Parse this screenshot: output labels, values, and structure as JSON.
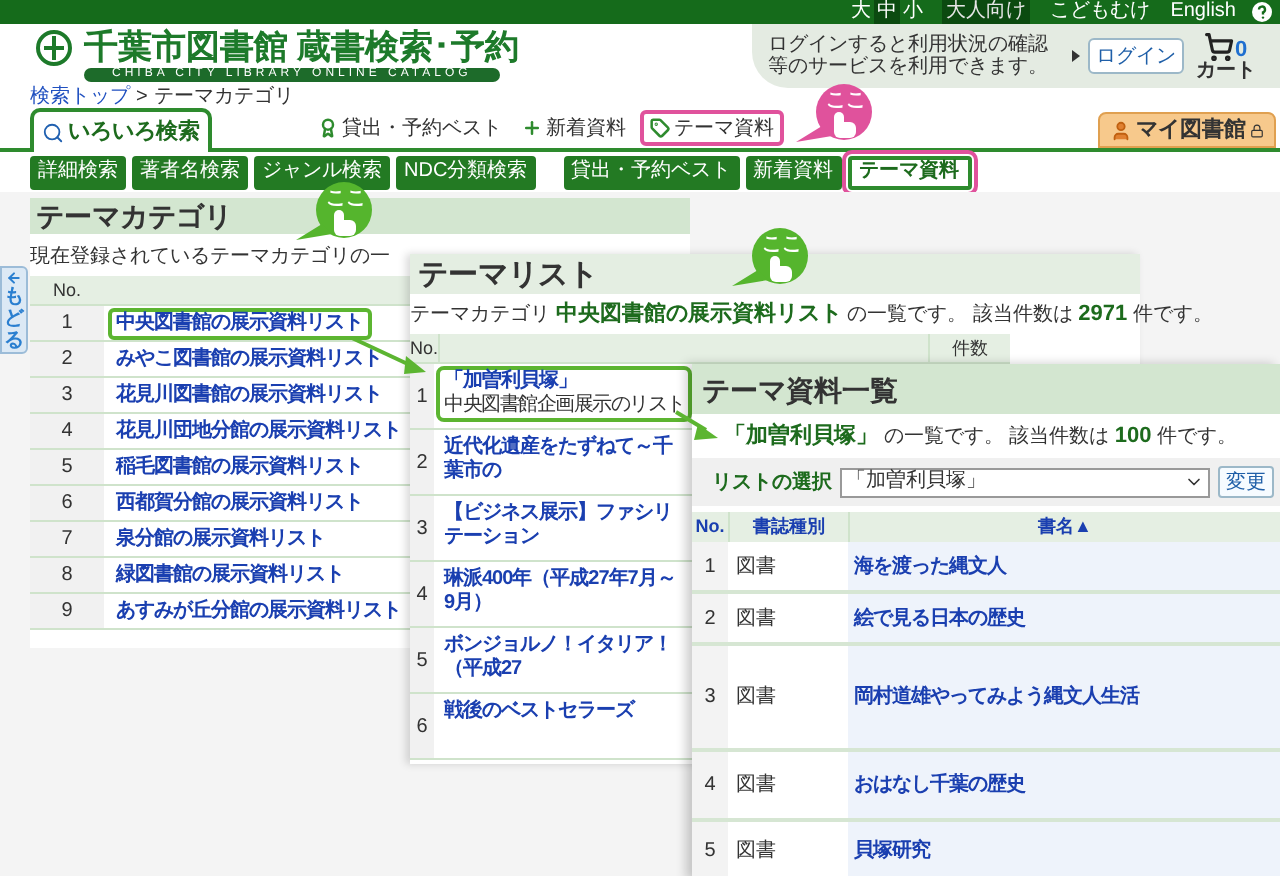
{
  "top_bar": {
    "font_sizes": [
      {
        "label": "大",
        "selected": false
      },
      {
        "label": "中",
        "selected": true
      },
      {
        "label": "小",
        "selected": false
      }
    ],
    "audiences": [
      {
        "label": "大人向け",
        "selected": true
      },
      {
        "label": "こどもむけ",
        "selected": false
      }
    ],
    "language": "English"
  },
  "header": {
    "title": "千葉市図書館 蔵書検索･予約",
    "subtitle": "CHIBA CITY LIBRARY ONLINE CATALOG",
    "login_note": "ログインすると利用状況の確認等のサービスを利用できます。",
    "login_button": "ログイン",
    "cart_count": "0",
    "cart_label": "カート"
  },
  "breadcrumb": {
    "link": "検索トップ",
    "separator": ">",
    "current": "テーマカテゴリ"
  },
  "main_tabs": [
    {
      "label": "いろいろ検索",
      "kind": "tab",
      "selected": true,
      "highlighted": false
    },
    {
      "label": "貸出・予約ベスト",
      "kind": "best",
      "selected": false,
      "highlighted": false
    },
    {
      "label": "新着資料",
      "kind": "new",
      "selected": false,
      "highlighted": false
    },
    {
      "label": "テーマ資料",
      "kind": "theme",
      "selected": false,
      "highlighted": true
    }
  ],
  "my_library": "マイ図書館",
  "search_buttons": [
    {
      "label": "詳細検索",
      "selected": false,
      "highlighted": false
    },
    {
      "label": "著者名検索",
      "selected": false,
      "highlighted": false
    },
    {
      "label": "ジャンル検索",
      "selected": false,
      "highlighted": false
    },
    {
      "label": "NDC分類検索",
      "selected": false,
      "highlighted": false
    }
  ],
  "list_buttons": [
    {
      "label": "貸出・予約ベスト",
      "selected": false,
      "highlighted": false
    },
    {
      "label": "新着資料",
      "selected": false,
      "highlighted": false
    },
    {
      "label": "テーマ資料",
      "selected": true,
      "highlighted": true
    }
  ],
  "back_tab": "もどる",
  "category_panel": {
    "title": "テーマカテゴリ",
    "description": "現在登録されているテーマカテゴリの一",
    "column": "No.",
    "rows": [
      {
        "no": "1",
        "name": "中央図書館の展示資料リスト",
        "highlighted": true
      },
      {
        "no": "2",
        "name": "みやこ図書館の展示資料リスト",
        "highlighted": false
      },
      {
        "no": "3",
        "name": "花見川図書館の展示資料リスト",
        "highlighted": false
      },
      {
        "no": "4",
        "name": "花見川団地分館の展示資料リスト",
        "highlighted": false
      },
      {
        "no": "5",
        "name": "稲毛図書館の展示資料リスト",
        "highlighted": false
      },
      {
        "no": "6",
        "name": "西都賀分館の展示資料リスト",
        "highlighted": false
      },
      {
        "no": "7",
        "name": "泉分館の展示資料リスト",
        "highlighted": false
      },
      {
        "no": "8",
        "name": "緑図書館の展示資料リスト",
        "highlighted": false
      },
      {
        "no": "9",
        "name": "あすみが丘分館の展示資料リスト",
        "highlighted": false
      }
    ]
  },
  "list_panel": {
    "title": "テーマリスト",
    "description": "テーマカテゴリ **中央図書館の展示資料リスト** の一覧です。 該当件数は **2971** 件です。",
    "columns": [
      "No.",
      "件数"
    ],
    "rows": [
      {
        "no": "1",
        "title": "「加曽利貝塚」",
        "note": "中央図書館企画展示のリスト",
        "highlighted": true
      },
      {
        "no": "2",
        "title": "近代化遺産をたずねて～千葉市の",
        "highlighted": false
      },
      {
        "no": "3",
        "title": "【ビジネス展示】ファシリテーション",
        "highlighted": false
      },
      {
        "no": "4",
        "title": "琳派400年（平成27年7月～9月）",
        "highlighted": false
      },
      {
        "no": "5",
        "title": "ボンジョルノ！イタリア！（平成27",
        "highlighted": false
      },
      {
        "no": "6",
        "title": "戦後のベストセラーズ",
        "highlighted": false
      }
    ]
  },
  "items_panel": {
    "title": "テーマ資料一覧",
    "description": "**「加曽利貝塚」** の一覧です。 該当件数は **100** 件です。",
    "select_label": "リストの選択",
    "select_value": "「加曽利貝塚」",
    "change_button": "変更",
    "columns": [
      "No.",
      "書誌種別",
      "書名▲"
    ],
    "rows": [
      {
        "no": "1",
        "type": "図書",
        "title": "海を渡った縄文人"
      },
      {
        "no": "2",
        "type": "図書",
        "title": "絵で見る日本の歴史"
      },
      {
        "no": "3",
        "type": "図書",
        "title": "岡村道雄やってみよう縄文人生活"
      },
      {
        "no": "4",
        "type": "図書",
        "title": "おはなし千葉の歴史"
      },
      {
        "no": "5",
        "type": "図書",
        "title": "貝塚研究"
      }
    ]
  },
  "callouts": [
    {
      "text": "ここ",
      "color": "#e0529c"
    },
    {
      "text": "ここ",
      "color": "#55b52d"
    },
    {
      "text": "ここ",
      "color": "#55b52d"
    }
  ]
}
